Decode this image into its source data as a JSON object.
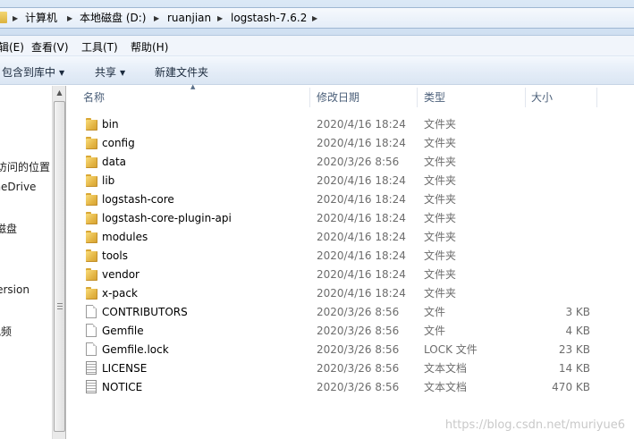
{
  "address": {
    "crumbs": [
      "计算机",
      "本地磁盘 (D:)",
      "ruanjian",
      "logstash-7.6.2"
    ]
  },
  "menu": {
    "items": [
      "编辑(E)",
      "查看(V)",
      "工具(T)",
      "帮助(H)"
    ]
  },
  "toolbar": {
    "include_label": "包含到库中",
    "share_label": "共享",
    "new_folder_label": "新建文件夹"
  },
  "nav": {
    "items": [
      "最近访问的位置",
      "OneDrive",
      "本地磁盘",
      "version",
      "视频"
    ]
  },
  "columns": {
    "name": "名称",
    "date": "修改日期",
    "type": "类型",
    "size": "大小"
  },
  "files": [
    {
      "name": "bin",
      "date": "2020/4/16 18:24",
      "type": "文件夹",
      "size": "",
      "icon": "folder-icon"
    },
    {
      "name": "config",
      "date": "2020/4/16 18:24",
      "type": "文件夹",
      "size": "",
      "icon": "folder-icon"
    },
    {
      "name": "data",
      "date": "2020/3/26 8:56",
      "type": "文件夹",
      "size": "",
      "icon": "folder-icon"
    },
    {
      "name": "lib",
      "date": "2020/4/16 18:24",
      "type": "文件夹",
      "size": "",
      "icon": "folder-icon"
    },
    {
      "name": "logstash-core",
      "date": "2020/4/16 18:24",
      "type": "文件夹",
      "size": "",
      "icon": "folder-icon"
    },
    {
      "name": "logstash-core-plugin-api",
      "date": "2020/4/16 18:24",
      "type": "文件夹",
      "size": "",
      "icon": "folder-icon"
    },
    {
      "name": "modules",
      "date": "2020/4/16 18:24",
      "type": "文件夹",
      "size": "",
      "icon": "folder-icon"
    },
    {
      "name": "tools",
      "date": "2020/4/16 18:24",
      "type": "文件夹",
      "size": "",
      "icon": "folder-icon"
    },
    {
      "name": "vendor",
      "date": "2020/4/16 18:24",
      "type": "文件夹",
      "size": "",
      "icon": "folder-icon"
    },
    {
      "name": "x-pack",
      "date": "2020/4/16 18:24",
      "type": "文件夹",
      "size": "",
      "icon": "folder-icon"
    },
    {
      "name": "CONTRIBUTORS",
      "date": "2020/3/26 8:56",
      "type": "文件",
      "size": "3 KB",
      "icon": "file-icon"
    },
    {
      "name": "Gemfile",
      "date": "2020/3/26 8:56",
      "type": "文件",
      "size": "4 KB",
      "icon": "file-icon"
    },
    {
      "name": "Gemfile.lock",
      "date": "2020/3/26 8:56",
      "type": "LOCK 文件",
      "size": "23 KB",
      "icon": "file-icon"
    },
    {
      "name": "LICENSE",
      "date": "2020/3/26 8:56",
      "type": "文本文档",
      "size": "14 KB",
      "icon": "text-file-icon"
    },
    {
      "name": "NOTICE",
      "date": "2020/3/26 8:56",
      "type": "文本文档",
      "size": "470 KB",
      "icon": "text-file-icon"
    }
  ],
  "watermark": "https://blog.csdn.net/muriyue6"
}
